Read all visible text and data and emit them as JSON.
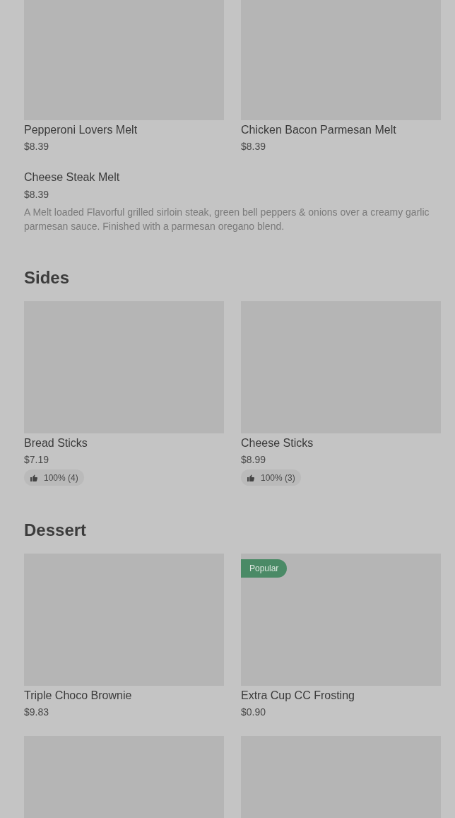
{
  "sections": [
    {
      "items": [
        {
          "kind": "card",
          "name": "Pepperoni Lovers Melt",
          "price": "$8.39"
        },
        {
          "kind": "card",
          "name": "Chicken Bacon Parmesan Melt",
          "price": "$8.39"
        },
        {
          "kind": "text",
          "name": "Cheese Steak Melt",
          "price": "$8.39",
          "description": "A Melt loaded Flavorful grilled sirloin steak, green bell peppers & onions over a creamy garlic parmesan sauce. Finished with a parmesan oregano blend."
        }
      ]
    },
    {
      "title": "Sides",
      "items": [
        {
          "kind": "card",
          "name": "Bread Sticks",
          "price": "$7.19",
          "rating": "100% (4)"
        },
        {
          "kind": "card",
          "name": "Cheese Sticks",
          "price": "$8.99",
          "rating": "100% (3)"
        }
      ]
    },
    {
      "title": "Dessert",
      "items": [
        {
          "kind": "card",
          "name": "Triple Choco Brownie",
          "price": "$9.83"
        },
        {
          "kind": "card",
          "name": "Extra Cup CC Frosting",
          "price": "$0.90",
          "badge": "Popular"
        },
        {
          "kind": "image_only"
        },
        {
          "kind": "image_only"
        }
      ]
    }
  ]
}
